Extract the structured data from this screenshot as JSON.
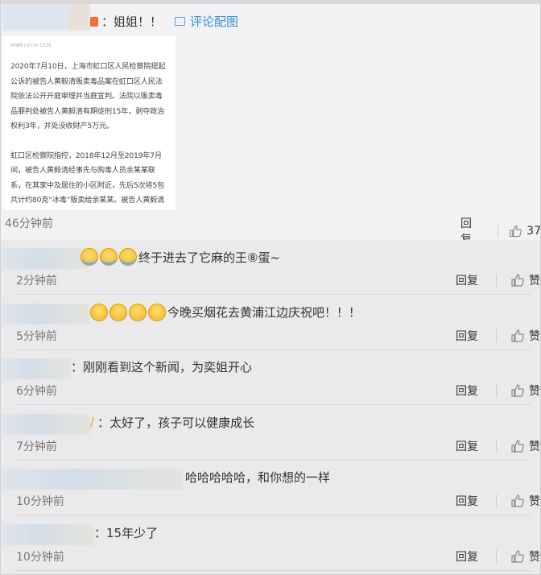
{
  "main_comment": {
    "text": "：姐姐！！",
    "pic_link": "评论配图",
    "image": {
      "source_line": "环球网 | 07-10 13:36",
      "paragraphs": [
        "2020年7月10日，上海市虹口区人民检察院提起公诉的被告人黄毅清贩卖毒品案在虹口区人民法院依法公开开庭审理并当庭宣判。法院以贩卖毒品罪判处被告人黄毅清有期徒刑15年，剥夺政治权利3年，并处没收财产5万元。",
        "虹口区检察院指控，2018年12月至2019年7月间，被告人黄毅清经事先与购毒人员余某某联系，在其家中及居住的小区附近，先后5次将5包共计约80克“冰毒”贩卖给余某某。被告人黄毅清明知是毒品仍予以贩卖，其行"
      ]
    },
    "time": "46分钟前",
    "reply_label": "回复",
    "like_count": "37"
  },
  "replies": [
    {
      "text": "终于进去了它麻的王⑧蛋~",
      "time": "2分钟前",
      "reply_label": "回复",
      "like_label": "赞"
    },
    {
      "text": "今晚买烟花去黄浦江边庆祝吧！！！",
      "time": "5分钟前",
      "reply_label": "回复",
      "like_label": "赞"
    },
    {
      "text": "：刚刚看到这个新闻，为奕姐开心",
      "time": "6分钟前",
      "reply_label": "回复",
      "like_label": "赞"
    },
    {
      "text": "：太好了，孩子可以健康成长",
      "time": "7分钟前",
      "reply_label": "回复",
      "like_label": "赞"
    },
    {
      "text": "哈哈哈哈哈，和你想的一样",
      "time": "10分钟前",
      "reply_label": "回复",
      "like_label": "赞"
    },
    {
      "text": "：15年少了",
      "time": "10分钟前",
      "reply_label": "回复",
      "like_label": "赞"
    }
  ],
  "colors": {
    "link": "#3a8fd6",
    "muted": "#777777"
  }
}
